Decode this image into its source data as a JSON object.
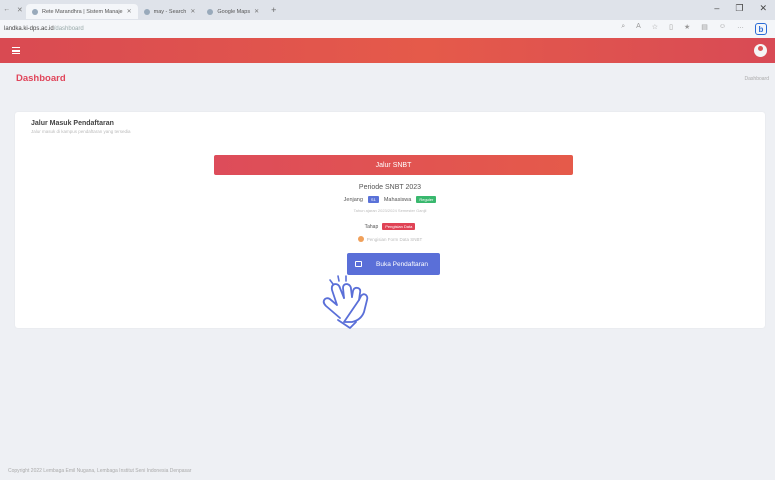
{
  "browser": {
    "tabs": [
      {
        "label": "Rete Marandhra | Sistem Manaje"
      },
      {
        "label": "may - Search"
      },
      {
        "label": "Google Maps"
      }
    ],
    "address_host": "landka.ki-dps.ac.id",
    "address_path": "/dashboard"
  },
  "app": {
    "page_title": "Dashboard",
    "breadcrumb": "Dashboard"
  },
  "card": {
    "title": "Jalur Masuk Pendaftaran",
    "subtitle": "Jalur masuk di kampus pendaftaran yang tersedia",
    "jalur_button": "Jalur SNBT",
    "periode": "Periode SNBT 2023",
    "jenjang_label": "Jenjang",
    "jenjang_badge": "S1",
    "mahasiswa_label": "Mahasiswa",
    "mahasiswa_badge": "Reguler",
    "tahun_note": "Tahun ajaran 2023/2024 Semester Ganjil",
    "tahap_label": "Tahap",
    "tahap_badge": "Pengisian Data",
    "pengisian_note": "Pengisian Form Data SNBT",
    "buka_button": "Buka Pendaftaran"
  },
  "footer": {
    "text": "Copyright 2022 Lembaga Emil Nugana, Lembaga Institut Seni Indonesia Denpasar"
  },
  "colors": {
    "brand": "#e0455a",
    "primary_button": "#5a6fd8",
    "success": "#39b86e"
  }
}
